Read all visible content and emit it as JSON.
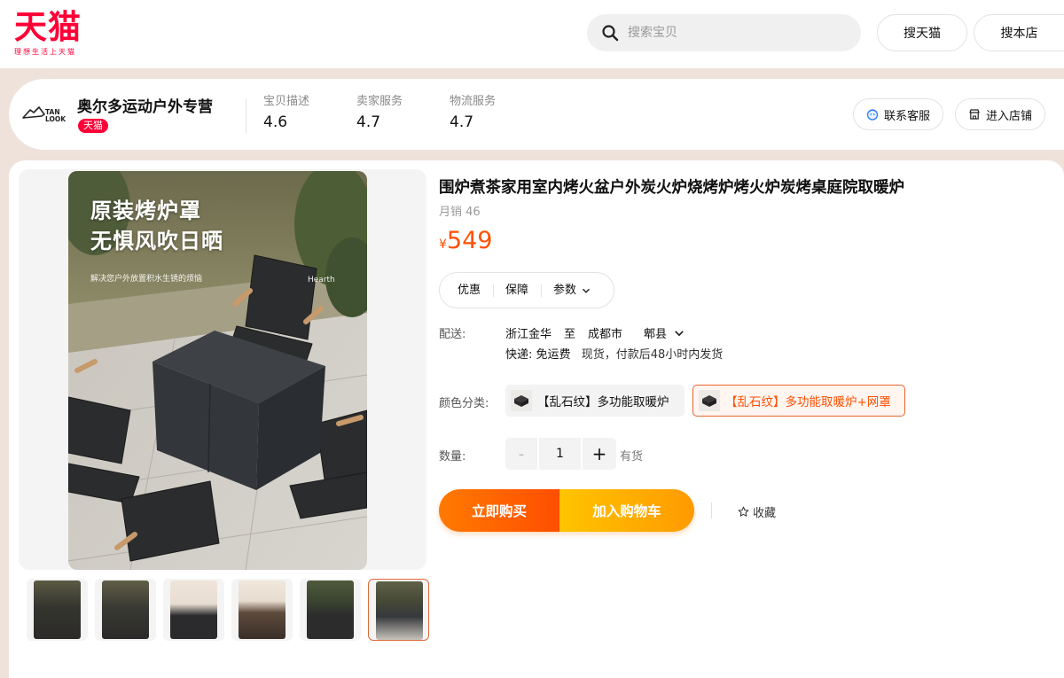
{
  "header": {
    "logo_text": "天猫",
    "logo_slogan": "理想生活上天猫",
    "search_placeholder": "搜索宝贝",
    "search_tmall_label": "搜天猫",
    "search_store_label": "搜本店"
  },
  "shop": {
    "name": "奥尔多运动户外专营",
    "badge": "天猫",
    "logo_text": "TAN LOOK",
    "scores": [
      {
        "label": "宝贝描述",
        "value": "4.6"
      },
      {
        "label": "卖家服务",
        "value": "4.7"
      },
      {
        "label": "物流服务",
        "value": "4.7"
      }
    ],
    "contact_label": "联系客服",
    "enter_label": "进入店铺"
  },
  "gallery": {
    "headline_line1": "原装烤炉罩",
    "headline_line2": "无惧风吹日晒",
    "caption": "解决您户外放置积水生锈的烦恼",
    "brand": "Hearth",
    "thumbnail_count": 6,
    "selected_thumbnail": 6
  },
  "product": {
    "title": "围炉煮茶家用室内烤火盆户外炭火炉烧烤炉烤火炉炭烤桌庭院取暖炉",
    "monthly_sales": "月销 46",
    "price_symbol": "¥",
    "price": "549",
    "tabs": [
      "优惠",
      "保障",
      "参数"
    ]
  },
  "shipping": {
    "label": "配送:",
    "from": "浙江金华",
    "to_word": "至",
    "city": "成都市",
    "district": "郫县",
    "express_label": "快递:",
    "express_info": "免运费",
    "stock_info": "现货，付款后48小时内发货"
  },
  "color": {
    "label": "颜色分类:",
    "options": [
      "【乱石纹】多功能取暖炉",
      "【乱石纹】多功能取暖炉+网罩"
    ],
    "selected_index": 1
  },
  "quantity": {
    "label": "数量:",
    "minus": "-",
    "value": "1",
    "plus": "+",
    "stock": "有货"
  },
  "actions": {
    "buy_now": "立即购买",
    "add_to_cart": "加入购物车",
    "favorite": "收藏"
  },
  "colors": {
    "brand": "#ff0036",
    "price": "#ff5000",
    "band": "#eee2da"
  }
}
